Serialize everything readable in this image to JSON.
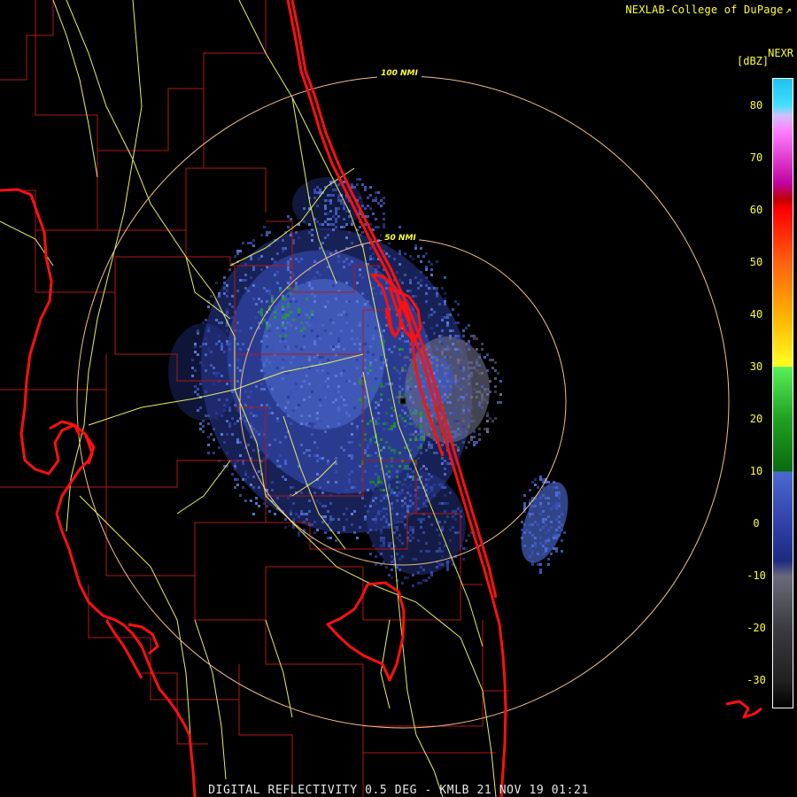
{
  "credit": "NEXLAB-College of DuPage",
  "credit_icon": "cursor-arrow-icon",
  "product": "NEXR",
  "legend": {
    "unit": "[dBZ]",
    "ticks": [
      "80",
      "70",
      "60",
      "50",
      "40",
      "30",
      "20",
      "10",
      "0",
      "-10",
      "-20",
      "-30"
    ],
    "min": -35,
    "max": 85,
    "color_stops": [
      {
        "dbz": -35,
        "color": "#000000"
      },
      {
        "dbz": -30,
        "color": "#202020"
      },
      {
        "dbz": -20,
        "color": "#3a3a40"
      },
      {
        "dbz": -10,
        "color": "#6a6a7a"
      },
      {
        "dbz": -7,
        "color": "#1c2a80"
      },
      {
        "dbz": 0,
        "color": "#3040a8"
      },
      {
        "dbz": 10,
        "color": "#4a6ad0"
      },
      {
        "dbz": 10.1,
        "color": "#0a6a10"
      },
      {
        "dbz": 20,
        "color": "#20a020"
      },
      {
        "dbz": 30,
        "color": "#5af05a"
      },
      {
        "dbz": 30.1,
        "color": "#ffff20"
      },
      {
        "dbz": 40,
        "color": "#ffb000"
      },
      {
        "dbz": 50,
        "color": "#ff6010"
      },
      {
        "dbz": 60,
        "color": "#ff0000"
      },
      {
        "dbz": 62,
        "color": "#c00000"
      },
      {
        "dbz": 65,
        "color": "#c000a0"
      },
      {
        "dbz": 75,
        "color": "#ff80ff"
      },
      {
        "dbz": 78,
        "color": "#d0c0ff"
      },
      {
        "dbz": 80,
        "color": "#40e0ff"
      },
      {
        "dbz": 85,
        "color": "#20c0f0"
      }
    ]
  },
  "range_rings": [
    "100 NMI",
    "50 NMI"
  ],
  "caption": "DIGITAL REFLECTIVITY 0.5 DEG - KMLB 21 NOV 19 01:21",
  "colors": {
    "background": "#000000",
    "coastline": "#ff1010",
    "county_lines": "#b01818",
    "roads": "#e8f060",
    "range_ring": "#f0c090",
    "echo_light": "#3050c0",
    "echo_mid": "#5070d8",
    "echo_gray": "#707088",
    "echo_green": "#20a030"
  }
}
